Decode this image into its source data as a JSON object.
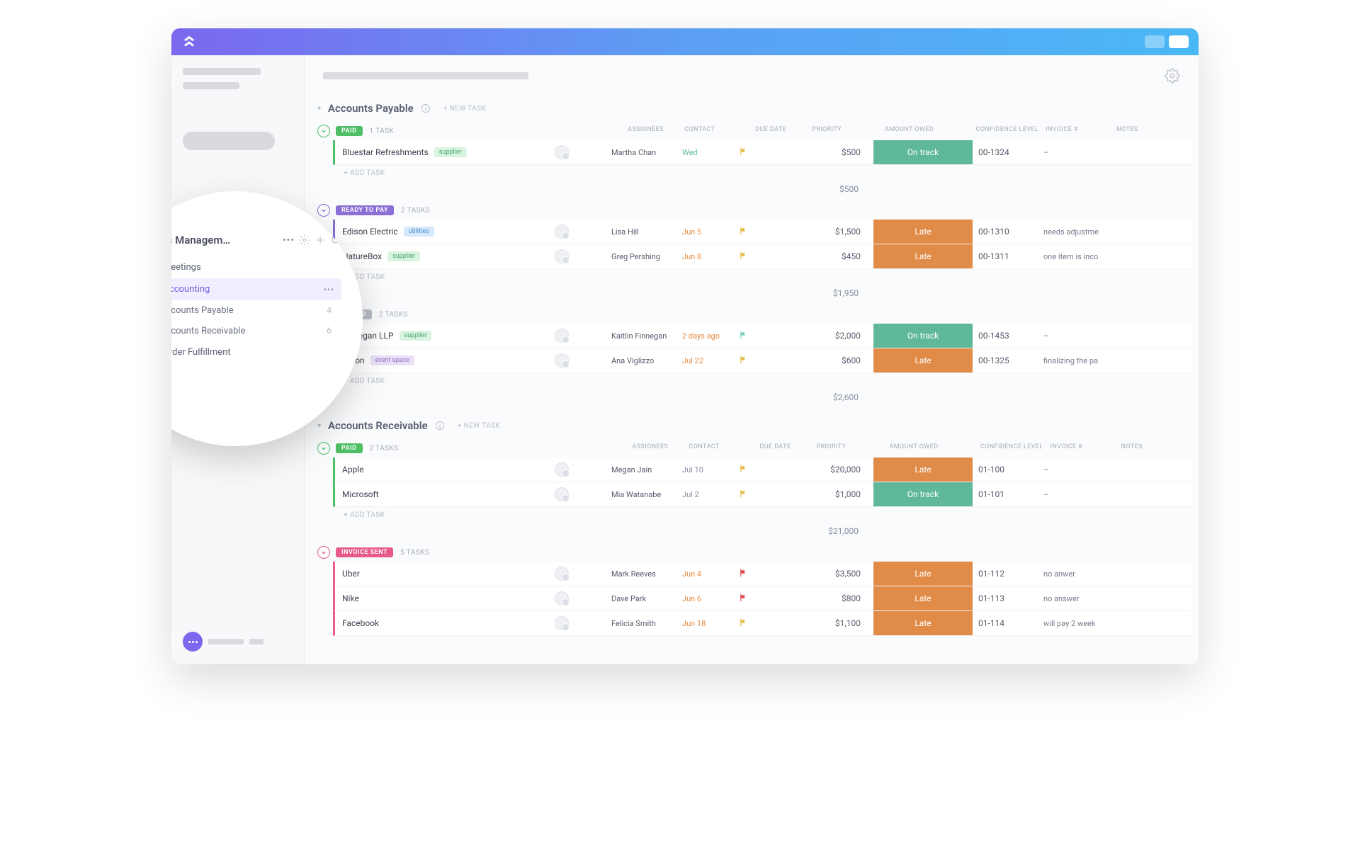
{
  "sidebar_popup": {
    "title": "Business Managem…",
    "items": [
      {
        "label": "Meetings",
        "active": false
      },
      {
        "label": "Accounting",
        "active": true
      },
      {
        "label": "Order Fulfillment",
        "active": false
      }
    ],
    "sublists": [
      {
        "label": "Accounts Payable",
        "count": "4"
      },
      {
        "label": "Accounts Receivable",
        "count": "6"
      }
    ]
  },
  "columns": {
    "assignees": "ASSIGNEES",
    "contact": "CONTACT",
    "due": "DUE DATE",
    "priority": "PRIORITY",
    "amount": "AMOUNT OWED",
    "confidence": "CONFIDENCE LEVEL",
    "invoice": "INVOICE #",
    "notes": "NOTES"
  },
  "labels": {
    "new_task": "+ NEW TASK",
    "add_task": "+ ADD TASK"
  },
  "confidence": {
    "on_track": {
      "label": "On track",
      "color": "#5fb89a"
    },
    "late": {
      "label": "Late",
      "color": "#e08b47"
    }
  },
  "groups": [
    {
      "title": "Accounts Payable",
      "statuses": [
        {
          "name": "PAID",
          "color": "#4fbf67",
          "count_label": "1 TASK",
          "tasks": [
            {
              "name": "Bluestar Refreshments",
              "tag": "supplier",
              "tag_class": "tag-supplier",
              "contact": "Martha Chan",
              "due": "Wed",
              "due_class": "",
              "due_color": "#5fb89a",
              "flag": "#e8bb4a",
              "amount": "$500",
              "confidence": "on_track",
              "invoice": "00-1324",
              "notes": "–"
            }
          ],
          "subtotal": "$500"
        },
        {
          "name": "READY TO PAY",
          "color": "#8b6fd4",
          "count_label": "2 TASKS",
          "tasks": [
            {
              "name": "Edison Electric",
              "tag": "utilities",
              "tag_class": "tag-utilities",
              "contact": "Lisa Hill",
              "due": "Jun 5",
              "due_class": "due-orange",
              "flag": "#e8bb4a",
              "amount": "$1,500",
              "confidence": "late",
              "invoice": "00-1310",
              "notes": "needs adjustme"
            },
            {
              "name": "NatureBox",
              "tag": "supplier",
              "tag_class": "tag-supplier",
              "contact": "Greg Pershing",
              "due": "Jun 8",
              "due_class": "due-orange",
              "flag": "#e8bb4a",
              "amount": "$450",
              "confidence": "late",
              "invoice": "00-1311",
              "notes": "one item is inco"
            }
          ],
          "subtotal": "$1,950"
        },
        {
          "name": "UNPAID",
          "color": "#b8bcc7",
          "count_label": "2 TASKS",
          "tasks": [
            {
              "name": "Finnegan LLP",
              "tag": "supplier",
              "tag_class": "tag-supplier",
              "contact": "Kaitlin Finnegan",
              "due": "2 days ago",
              "due_class": "due-orange",
              "flag": "#7ecfc0",
              "amount": "$2,000",
              "confidence": "on_track",
              "invoice": "00-1453",
              "notes": "–"
            },
            {
              "name": "Hilton",
              "tag": "event space",
              "tag_class": "tag-event",
              "contact": "Ana Viglizzo",
              "due": "Jul 22",
              "due_class": "due-orange",
              "flag": "#e8bb4a",
              "amount": "$600",
              "confidence": "late",
              "invoice": "00-1325",
              "notes": "finalizing the pa"
            }
          ],
          "subtotal": "$2,600"
        }
      ]
    },
    {
      "title": "Accounts Receivable",
      "statuses": [
        {
          "name": "PAID",
          "color": "#4fbf67",
          "count_label": "2 TASKS",
          "tasks": [
            {
              "name": "Apple",
              "tag": "",
              "contact": "Megan Jain",
              "due": "Jul 10",
              "due_class": "due-gray",
              "flag": "#e8bb4a",
              "amount": "$20,000",
              "confidence": "late",
              "invoice": "01-100",
              "notes": "–"
            },
            {
              "name": "Microsoft",
              "tag": "",
              "contact": "Mia Watanabe",
              "due": "Jul 2",
              "due_class": "due-gray",
              "flag": "#e8bb4a",
              "amount": "$1,000",
              "confidence": "on_track",
              "invoice": "01-101",
              "notes": "–"
            }
          ],
          "subtotal": "$21,000"
        },
        {
          "name": "INVOICE SENT",
          "color": "#e85a8c",
          "count_label": "5 TASKS",
          "tasks": [
            {
              "name": "Uber",
              "tag": "",
              "contact": "Mark Reeves",
              "due": "Jun 4",
              "due_class": "due-orange",
              "flag": "#e04848",
              "amount": "$3,500",
              "confidence": "late",
              "invoice": "01-112",
              "notes": "no anwer"
            },
            {
              "name": "Nike",
              "tag": "",
              "contact": "Dave Park",
              "due": "Jun 6",
              "due_class": "due-orange",
              "flag": "#e04848",
              "amount": "$800",
              "confidence": "late",
              "invoice": "01-113",
              "notes": "no answer"
            },
            {
              "name": "Facebook",
              "tag": "",
              "contact": "Felicia Smith",
              "due": "Jun 18",
              "due_class": "due-orange",
              "flag": "#e8bb4a",
              "amount": "$1,100",
              "confidence": "late",
              "invoice": "01-114",
              "notes": "will pay 2 week"
            }
          ],
          "subtotal": ""
        }
      ]
    }
  ]
}
